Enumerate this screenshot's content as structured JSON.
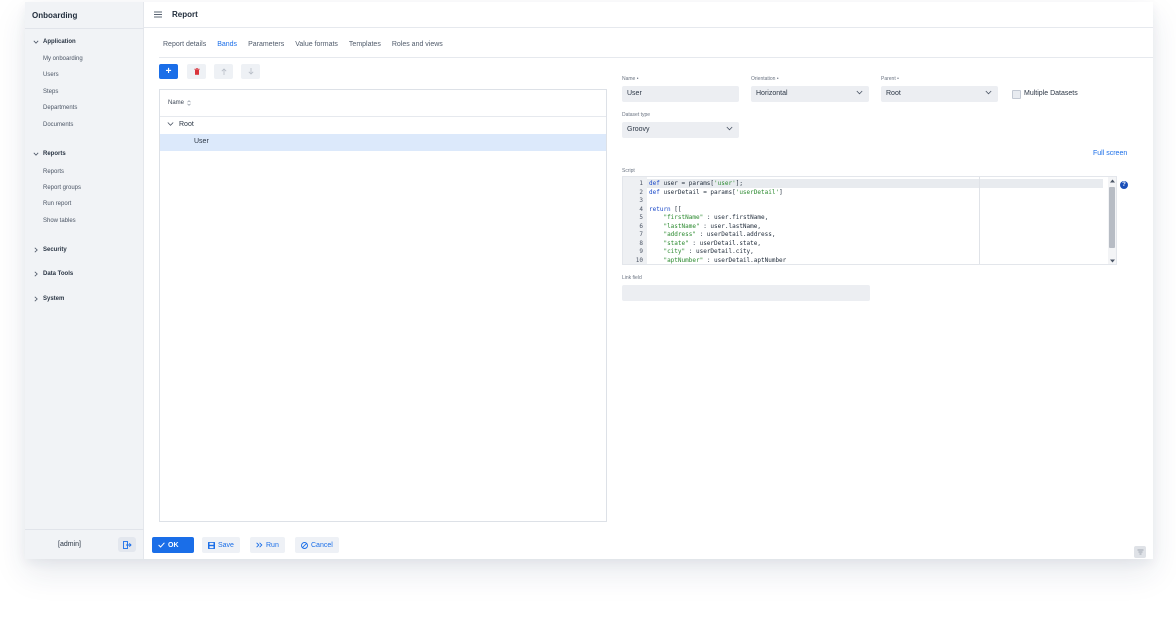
{
  "app": {
    "title": "Onboarding"
  },
  "sidebar": {
    "groups": [
      {
        "label": "Application",
        "expanded": true,
        "items": [
          "My onboarding",
          "Users",
          "Steps",
          "Departments",
          "Documents"
        ]
      },
      {
        "label": "Reports",
        "expanded": true,
        "items": [
          "Reports",
          "Report groups",
          "Run report",
          "Show tables"
        ]
      },
      {
        "label": "Security",
        "expanded": false,
        "items": []
      },
      {
        "label": "Data Tools",
        "expanded": false,
        "items": []
      },
      {
        "label": "System",
        "expanded": false,
        "items": []
      }
    ],
    "user": "[admin]"
  },
  "header": {
    "title": "Report"
  },
  "tabs": [
    {
      "label": "Report details",
      "active": false
    },
    {
      "label": "Bands",
      "active": true
    },
    {
      "label": "Parameters",
      "active": false
    },
    {
      "label": "Value formats",
      "active": false
    },
    {
      "label": "Templates",
      "active": false
    },
    {
      "label": "Roles and views",
      "active": false
    }
  ],
  "toolbar": {
    "add": "+"
  },
  "tree": {
    "column": "Name",
    "sort_icon": "sort-icon",
    "root": "Root",
    "child": "User"
  },
  "form": {
    "name_label": "Name",
    "name_value": "User",
    "orientation_label": "Orientation",
    "orientation_value": "Horizontal",
    "parent_label": "Parent",
    "parent_value": "Root",
    "multiple_datasets": "Multiple Datasets",
    "dataset_type_label": "Dataset type",
    "dataset_type_value": "Groovy",
    "full_screen": "Full screen",
    "script_label": "Script",
    "link_field_label": "Link field",
    "link_field_value": "",
    "required_mark": "•"
  },
  "script": {
    "line_numbers": [
      "1",
      "2",
      "3",
      "4",
      "5",
      "6",
      "7",
      "8",
      "9",
      "10"
    ]
  },
  "footer": {
    "ok": "OK",
    "save": "Save",
    "run": "Run",
    "cancel": "Cancel"
  },
  "colors": {
    "accent": "#1a6ee8",
    "delete": "#d9343b",
    "selected_row": "#dce9fb"
  }
}
